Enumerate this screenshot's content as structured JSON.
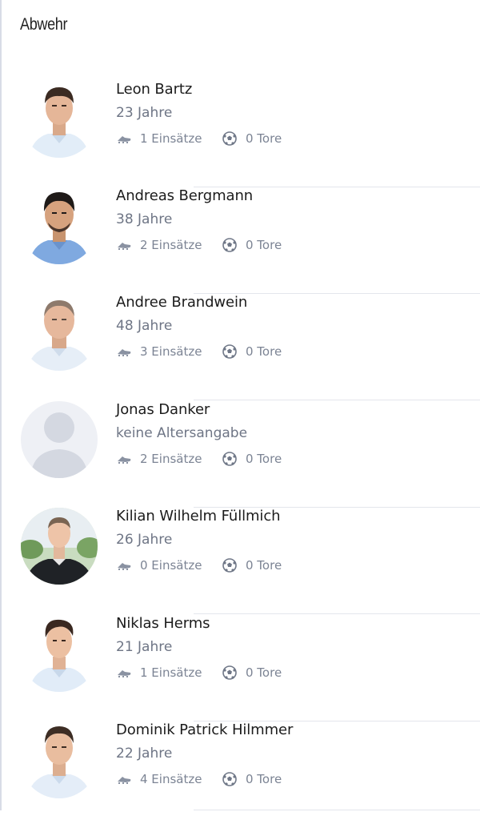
{
  "section": {
    "title": "Abwehr"
  },
  "stat_icons": {
    "appearances": "football-boot-icon",
    "goals": "soccer-ball-icon"
  },
  "players": [
    {
      "name": "Leon Bartz",
      "age": "23 Jahre",
      "appearances": "1 Einsätze",
      "goals": "0 Tore",
      "photo": "player-photo"
    },
    {
      "name": "Andreas Bergmann",
      "age": "38 Jahre",
      "appearances": "2 Einsätze",
      "goals": "0 Tore",
      "photo": "player-photo"
    },
    {
      "name": "Andree Brandwein",
      "age": "48 Jahre",
      "appearances": "3 Einsätze",
      "goals": "0 Tore",
      "photo": "player-photo"
    },
    {
      "name": "Jonas Danker",
      "age": "keine Altersangabe",
      "appearances": "2 Einsätze",
      "goals": "0 Tore",
      "photo": "placeholder-avatar"
    },
    {
      "name": "Kilian Wilhelm Füllmich",
      "age": "26 Jahre",
      "appearances": "0 Einsätze",
      "goals": "0 Tore",
      "photo": "player-photo"
    },
    {
      "name": "Niklas Herms",
      "age": "21 Jahre",
      "appearances": "1 Einsätze",
      "goals": "0 Tore",
      "photo": "player-photo"
    },
    {
      "name": "Dominik Patrick Hilmmer",
      "age": "22 Jahre",
      "appearances": "4 Einsätze",
      "goals": "0 Tore",
      "photo": "player-photo"
    }
  ],
  "colors": {
    "text_primary": "#1c1c1c",
    "text_secondary": "#6e7585",
    "stat_text": "#7c8494",
    "divider": "#e4e6ec",
    "placeholder_bg": "#eef0f5",
    "placeholder_fg": "#d4d8e1",
    "jersey_light": "#dde9f6"
  }
}
